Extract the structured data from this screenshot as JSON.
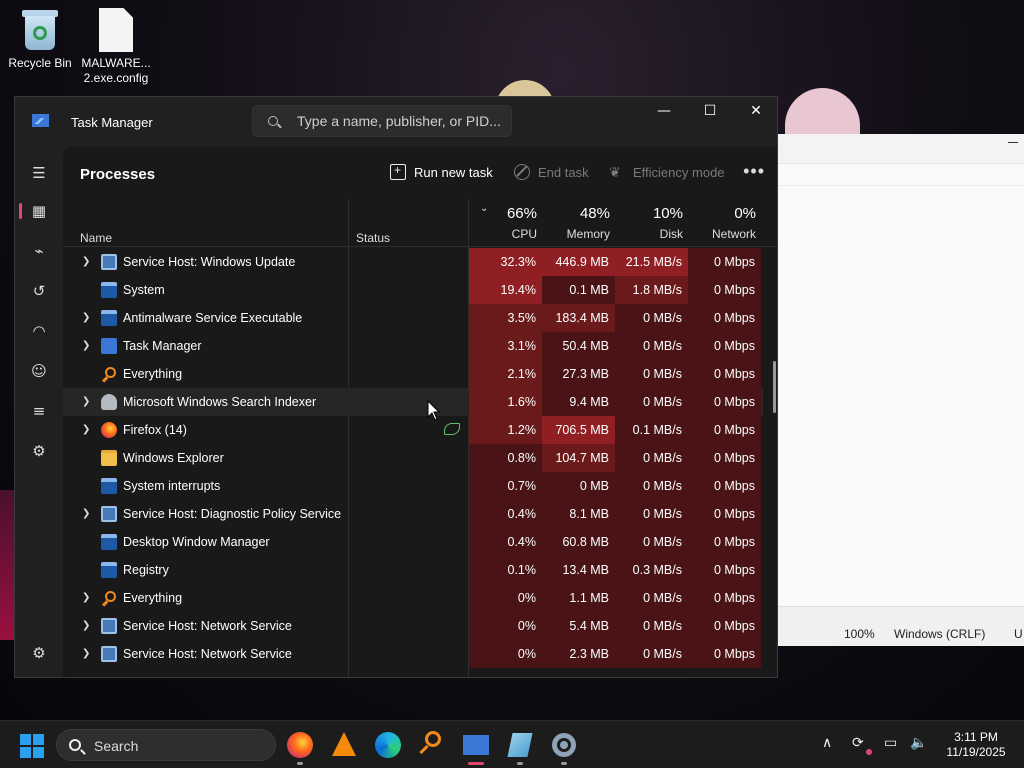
{
  "desktop": {
    "icons": [
      {
        "label": "Recycle Bin",
        "icon": "recycle-bin-icon"
      },
      {
        "label": "MALWARE...\n2.exe.config",
        "line1": "MALWARE...",
        "line2": "2.exe.config",
        "icon": "file-icon"
      }
    ]
  },
  "notepad": {
    "zoom": "100%",
    "line_ending": "Windows (CRLF)",
    "encoding_partial": "U"
  },
  "task_manager": {
    "title": "Task Manager",
    "search_placeholder": "Type a name, publisher, or PID...",
    "window_controls": {
      "minimize": "—",
      "maximize": "☐",
      "close": "✕"
    },
    "nav": [
      {
        "name": "hamburger-menu-icon",
        "glyph": "☰"
      },
      {
        "name": "processes-icon",
        "glyph": "▦",
        "active": true
      },
      {
        "name": "performance-icon",
        "glyph": "⌁"
      },
      {
        "name": "app-history-icon",
        "glyph": "↺"
      },
      {
        "name": "startup-apps-icon",
        "glyph": "◠"
      },
      {
        "name": "users-icon",
        "glyph": "☺"
      },
      {
        "name": "details-icon",
        "glyph": "≡"
      },
      {
        "name": "services-icon",
        "glyph": "⚙"
      },
      {
        "name": "settings-icon",
        "glyph": "⚙"
      }
    ],
    "toolbar": {
      "title": "Processes",
      "run_new_task": "Run new task",
      "end_task": "End task",
      "efficiency_mode": "Efficiency mode",
      "more": "•••"
    },
    "columns": {
      "name": "Name",
      "status": "Status",
      "cpu": {
        "pct": "66%",
        "label": "CPU"
      },
      "memory": {
        "pct": "48%",
        "label": "Memory"
      },
      "disk": {
        "pct": "10%",
        "label": "Disk"
      },
      "network": {
        "pct": "0%",
        "label": "Network"
      }
    },
    "processes": [
      {
        "name": "Service Host: Windows Update",
        "icon": "service-icon",
        "expand": true,
        "cpu": "32.3%",
        "mem": "446.9 MB",
        "disk": "21.5 MB/s",
        "net": "0 Mbps",
        "heat": [
          3,
          3,
          3,
          1
        ]
      },
      {
        "name": "System",
        "icon": "app-icon",
        "expand": false,
        "cpu": "19.4%",
        "mem": "0.1 MB",
        "disk": "1.8 MB/s",
        "net": "0 Mbps",
        "heat": [
          3,
          1,
          2,
          1
        ]
      },
      {
        "name": "Antimalware Service Executable",
        "icon": "app-icon",
        "expand": true,
        "cpu": "3.5%",
        "mem": "183.4 MB",
        "disk": "0 MB/s",
        "net": "0 Mbps",
        "heat": [
          2,
          2,
          1,
          1
        ]
      },
      {
        "name": "Task Manager",
        "icon": "task-manager-icon",
        "expand": true,
        "cpu": "3.1%",
        "mem": "50.4 MB",
        "disk": "0 MB/s",
        "net": "0 Mbps",
        "heat": [
          2,
          1,
          1,
          1
        ]
      },
      {
        "name": "Everything",
        "icon": "everything-search-icon",
        "expand": false,
        "cpu": "2.1%",
        "mem": "27.3 MB",
        "disk": "0 MB/s",
        "net": "0 Mbps",
        "heat": [
          2,
          1,
          1,
          1
        ]
      },
      {
        "name": "Microsoft Windows Search Indexer",
        "icon": "search-indexer-icon",
        "expand": true,
        "cpu": "1.6%",
        "mem": "9.4 MB",
        "disk": "0 MB/s",
        "net": "0 Mbps",
        "heat": [
          2,
          1,
          1,
          1
        ],
        "hover": true
      },
      {
        "name": "Firefox (14)",
        "icon": "firefox-icon",
        "expand": true,
        "status_icon": "efficiency-leaf-icon",
        "cpu": "1.2%",
        "mem": "706.5 MB",
        "disk": "0.1 MB/s",
        "net": "0 Mbps",
        "heat": [
          2,
          3,
          1,
          1
        ]
      },
      {
        "name": "Windows Explorer",
        "icon": "folder-icon",
        "expand": false,
        "cpu": "0.8%",
        "mem": "104.7 MB",
        "disk": "0 MB/s",
        "net": "0 Mbps",
        "heat": [
          1,
          2,
          1,
          1
        ]
      },
      {
        "name": "System interrupts",
        "icon": "app-icon",
        "expand": false,
        "cpu": "0.7%",
        "mem": "0 MB",
        "disk": "0 MB/s",
        "net": "0 Mbps",
        "heat": [
          1,
          1,
          1,
          1
        ]
      },
      {
        "name": "Service Host: Diagnostic Policy Service",
        "icon": "service-icon",
        "expand": true,
        "cpu": "0.4%",
        "mem": "8.1 MB",
        "disk": "0 MB/s",
        "net": "0 Mbps",
        "heat": [
          1,
          1,
          1,
          1
        ]
      },
      {
        "name": "Desktop Window Manager",
        "icon": "app-icon",
        "expand": false,
        "cpu": "0.4%",
        "mem": "60.8 MB",
        "disk": "0 MB/s",
        "net": "0 Mbps",
        "heat": [
          1,
          1,
          1,
          1
        ]
      },
      {
        "name": "Registry",
        "icon": "app-icon",
        "expand": false,
        "cpu": "0.1%",
        "mem": "13.4 MB",
        "disk": "0.3 MB/s",
        "net": "0 Mbps",
        "heat": [
          1,
          1,
          1,
          1
        ]
      },
      {
        "name": "Everything",
        "icon": "everything-search-icon",
        "expand": true,
        "cpu": "0%",
        "mem": "1.1 MB",
        "disk": "0 MB/s",
        "net": "0 Mbps",
        "heat": [
          1,
          1,
          1,
          1
        ]
      },
      {
        "name": "Service Host: Network Service",
        "icon": "service-icon",
        "expand": true,
        "cpu": "0%",
        "mem": "5.4 MB",
        "disk": "0 MB/s",
        "net": "0 Mbps",
        "heat": [
          1,
          1,
          1,
          1
        ]
      },
      {
        "name": "Service Host: Network Service",
        "icon": "service-icon",
        "expand": true,
        "cpu": "0%",
        "mem": "2.3 MB",
        "disk": "0 MB/s",
        "net": "0 Mbps",
        "heat": [
          1,
          1,
          1,
          1
        ]
      }
    ]
  },
  "heat_colors": {
    "1": "#4a1416",
    "2": "#6b1a1c",
    "3": "#8f1f22"
  },
  "taskbar": {
    "search_label": "Search",
    "apps": [
      "firefox-icon",
      "vlc-icon",
      "edge-icon",
      "everything-icon",
      "task-manager-icon",
      "notepad-icon",
      "settings-icon"
    ],
    "tray": {
      "chevron": "∧",
      "sync": "⟳",
      "display": "▭",
      "speaker": "🔈"
    },
    "time": "3:11 PM",
    "date": "11/19/2025"
  }
}
